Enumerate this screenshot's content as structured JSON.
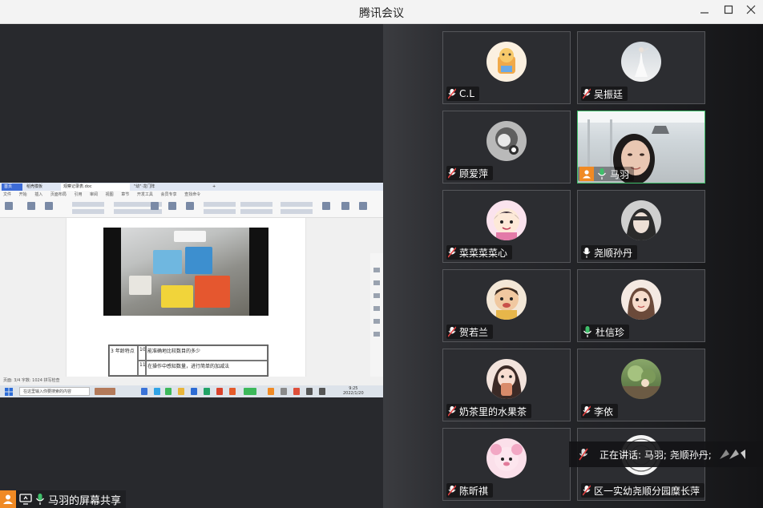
{
  "window": {
    "title": "腾讯会议"
  },
  "shared_screen": {
    "tabs": [
      "首页",
      "稻壳模板",
      "观察记录表.doc",
      "\"幼\"·龙门阵",
      "+"
    ],
    "ribbon_menu": [
      "文件",
      "开始",
      "插入",
      "页面布局",
      "引用",
      "审阅",
      "视图",
      "章节",
      "开发工具",
      "会员专享",
      "查找命令"
    ],
    "table_rows": [
      {
        "label": "3 年龄特点",
        "c1": "10",
        "text": "能准确地比较数目的多少"
      },
      {
        "label": "",
        "c1": "11",
        "text": "在操作中感知数量，进行简单的加减法"
      }
    ],
    "statusbar": "页面: 3/4  字数: 1024  拼写检查",
    "taskbar": {
      "search_placeholder": "在这里输入你要搜索的内容",
      "time": "9:25",
      "date": "2022/1/20"
    }
  },
  "share_status": {
    "label": "马羽的屏幕共享"
  },
  "participants": [
    {
      "name": "C.L",
      "muted": true,
      "avatar": "cartoon-avatar",
      "color": "#f4d6a0"
    },
    {
      "name": "吴振廷",
      "muted": true,
      "avatar": "photo-avatar",
      "color": "#d8d8d8"
    },
    {
      "name": "顾爱萍",
      "muted": true,
      "avatar": "cartoon-avatar",
      "color": "#8a8a8a"
    },
    {
      "name": "马羽",
      "muted": false,
      "video": true,
      "host": true,
      "avatar": "video",
      "color": "#3fbf6a"
    },
    {
      "name": "菜菜菜菜心",
      "muted": true,
      "avatar": "cartoon-avatar",
      "color": "#e37aa8"
    },
    {
      "name": "尧顺孙丹",
      "muted": false,
      "avatar": "photo-avatar",
      "color": "#9a9a9a"
    },
    {
      "name": "贺若兰",
      "muted": true,
      "avatar": "cartoon-avatar",
      "color": "#c7a06a"
    },
    {
      "name": "杜信珍",
      "muted": false,
      "speaking": true,
      "avatar": "photo-avatar",
      "color": "#e6cbb8"
    },
    {
      "name": "奶茶里的水果茶",
      "muted": true,
      "avatar": "photo-avatar",
      "color": "#e3c1b0"
    },
    {
      "name": "李依",
      "muted": true,
      "avatar": "photo-avatar",
      "color": "#6e8a55"
    },
    {
      "name": "陈昕祺",
      "muted": true,
      "avatar": "cartoon-avatar",
      "color": "#f2a8c4"
    },
    {
      "name": "区一实幼尧顺分园糜长萍",
      "muted": true,
      "avatar": "photo-avatar",
      "color": "#f4f4f4"
    }
  ],
  "speaking_banner": {
    "text": "正在讲话: 马羽; 尧顺孙丹;"
  }
}
